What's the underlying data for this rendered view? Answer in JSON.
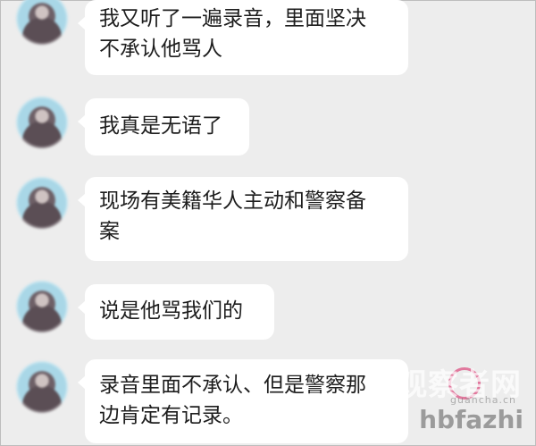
{
  "messages": [
    {
      "lines": [
        "我又听了一遍录音，里面坚决",
        "不承认他骂人"
      ]
    },
    {
      "lines": [
        "我真是无语了"
      ]
    },
    {
      "lines": [
        "现场有美籍华人主动和警察备",
        "案"
      ]
    },
    {
      "lines": [
        "说是他骂我们的"
      ]
    },
    {
      "lines": [
        "录音里面不承认、但是警察那",
        "边肯定有记录。"
      ]
    }
  ],
  "watermark": {
    "site_name": "观察者网",
    "site_url": "guancha.cn",
    "brand": "hbfazhi"
  }
}
